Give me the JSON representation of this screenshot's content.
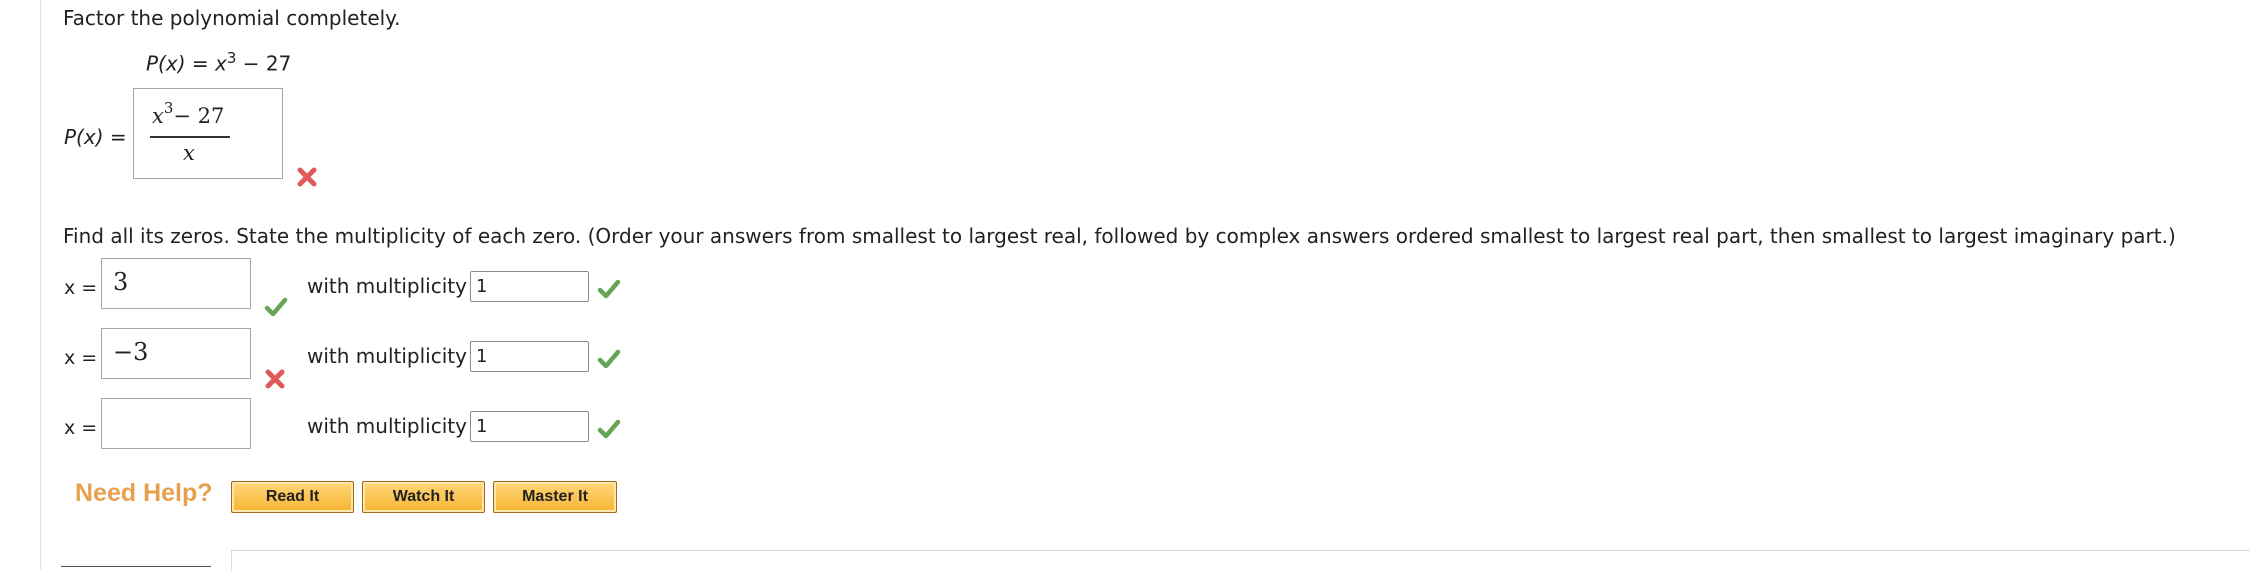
{
  "question": {
    "instruction": "Factor the polynomial completely.",
    "poly_lhs": "P(x)",
    "poly_eq": " = ",
    "poly_base": "x",
    "poly_exp": "3",
    "poly_rest": " − 27"
  },
  "factor_answer": {
    "label_lhs": "P(x)",
    "label_eq": " =",
    "num_base": "x",
    "num_exp": "3",
    "num_rest": "− 27",
    "denominator": "x",
    "status_icon": "x-mark-icon",
    "status_color": "#e05a5a"
  },
  "zeros_instruction": "Find all its zeros. State the multiplicity of each zero. (Order your answers from smallest to largest real, followed by complex answers ordered smallest to largest real part, then smallest to largest imaginary part.)",
  "zeros": [
    {
      "label": "x =",
      "value": "3",
      "value_status": "check-icon",
      "multiplicity_label": "with multiplicity",
      "multiplicity": "1",
      "multiplicity_status": "check-icon"
    },
    {
      "label": "x =",
      "value": "−3",
      "value_status": "x-mark-icon",
      "multiplicity_label": "with multiplicity",
      "multiplicity": "1",
      "multiplicity_status": "check-icon"
    },
    {
      "label": "x =",
      "value": "",
      "value_status": "",
      "multiplicity_label": "with multiplicity",
      "multiplicity": "1",
      "multiplicity_status": "check-icon"
    }
  ],
  "help": {
    "label": "Need Help?",
    "buttons": [
      "Read It",
      "Watch It",
      "Master It"
    ]
  },
  "colors": {
    "check": "#67a556",
    "cross": "#e05a5a",
    "need_help": "#e8a04f",
    "button_fill": "#f7b431"
  }
}
